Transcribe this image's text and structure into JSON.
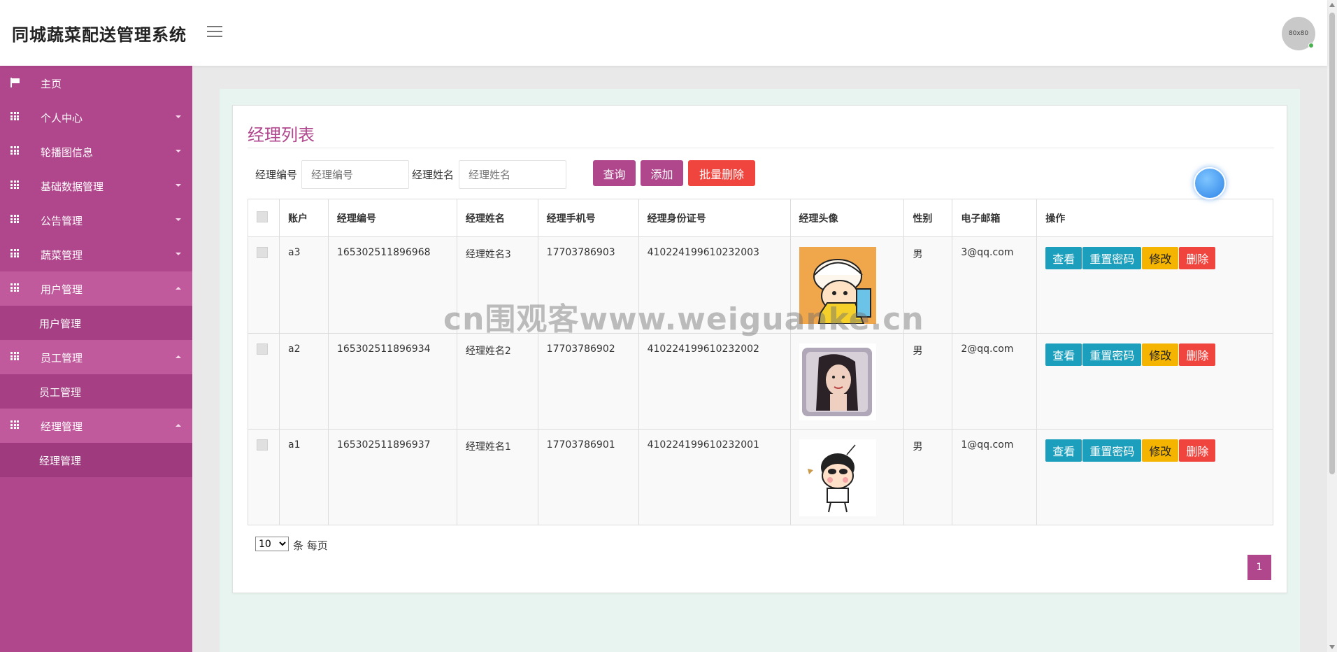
{
  "app": {
    "brand": "同城蔬菜配送管理系统",
    "avatar_text": "80x80"
  },
  "colors": {
    "accent": "#b0468c",
    "teal": "#1b9fbc",
    "warning": "#f5b400",
    "danger": "#f0443e"
  },
  "sidebar": {
    "items": [
      {
        "label": "主页",
        "icon": "flag-icon"
      },
      {
        "label": "个人中心",
        "icon": "grid-icon"
      },
      {
        "label": "轮播图信息",
        "icon": "grid-icon"
      },
      {
        "label": "基础数据管理",
        "icon": "grid-icon"
      },
      {
        "label": "公告管理",
        "icon": "grid-icon"
      },
      {
        "label": "蔬菜管理",
        "icon": "grid-icon"
      },
      {
        "label": "用户管理",
        "icon": "grid-icon",
        "sub": "用户管理"
      },
      {
        "label": "员工管理",
        "icon": "grid-icon",
        "sub": "员工管理"
      },
      {
        "label": "经理管理",
        "icon": "grid-icon",
        "sub": "经理管理"
      }
    ]
  },
  "page": {
    "title": "经理列表",
    "search": {
      "code_label": "经理编号",
      "code_placeholder": "经理编号",
      "name_label": "经理姓名",
      "name_placeholder": "经理姓名"
    },
    "buttons": {
      "query": "查询",
      "add": "添加",
      "batch_delete": "批量删除"
    },
    "table": {
      "headers": [
        "账户",
        "经理编号",
        "经理姓名",
        "经理手机号",
        "经理身份证号",
        "经理头像",
        "性别",
        "电子邮箱",
        "操作"
      ],
      "rows": [
        {
          "account": "a3",
          "code": "165302511896968",
          "name": "经理姓名3",
          "phone": "17703786903",
          "id_card": "410224199610232003",
          "gender": "男",
          "email": "3@qq.com"
        },
        {
          "account": "a2",
          "code": "165302511896934",
          "name": "经理姓名2",
          "phone": "17703786902",
          "id_card": "410224199610232002",
          "gender": "男",
          "email": "2@qq.com"
        },
        {
          "account": "a1",
          "code": "165302511896937",
          "name": "经理姓名1",
          "phone": "17703786901",
          "id_card": "410224199610232001",
          "gender": "男",
          "email": "1@qq.com"
        }
      ],
      "row_actions": {
        "view": "查看",
        "reset_password": "重置密码",
        "edit": "修改",
        "delete": "删除"
      }
    },
    "pagination": {
      "page_size": "10",
      "per_page_text": "条 每页",
      "current_page": "1"
    },
    "watermark": "cn围观客www.weiguanke.cn"
  }
}
